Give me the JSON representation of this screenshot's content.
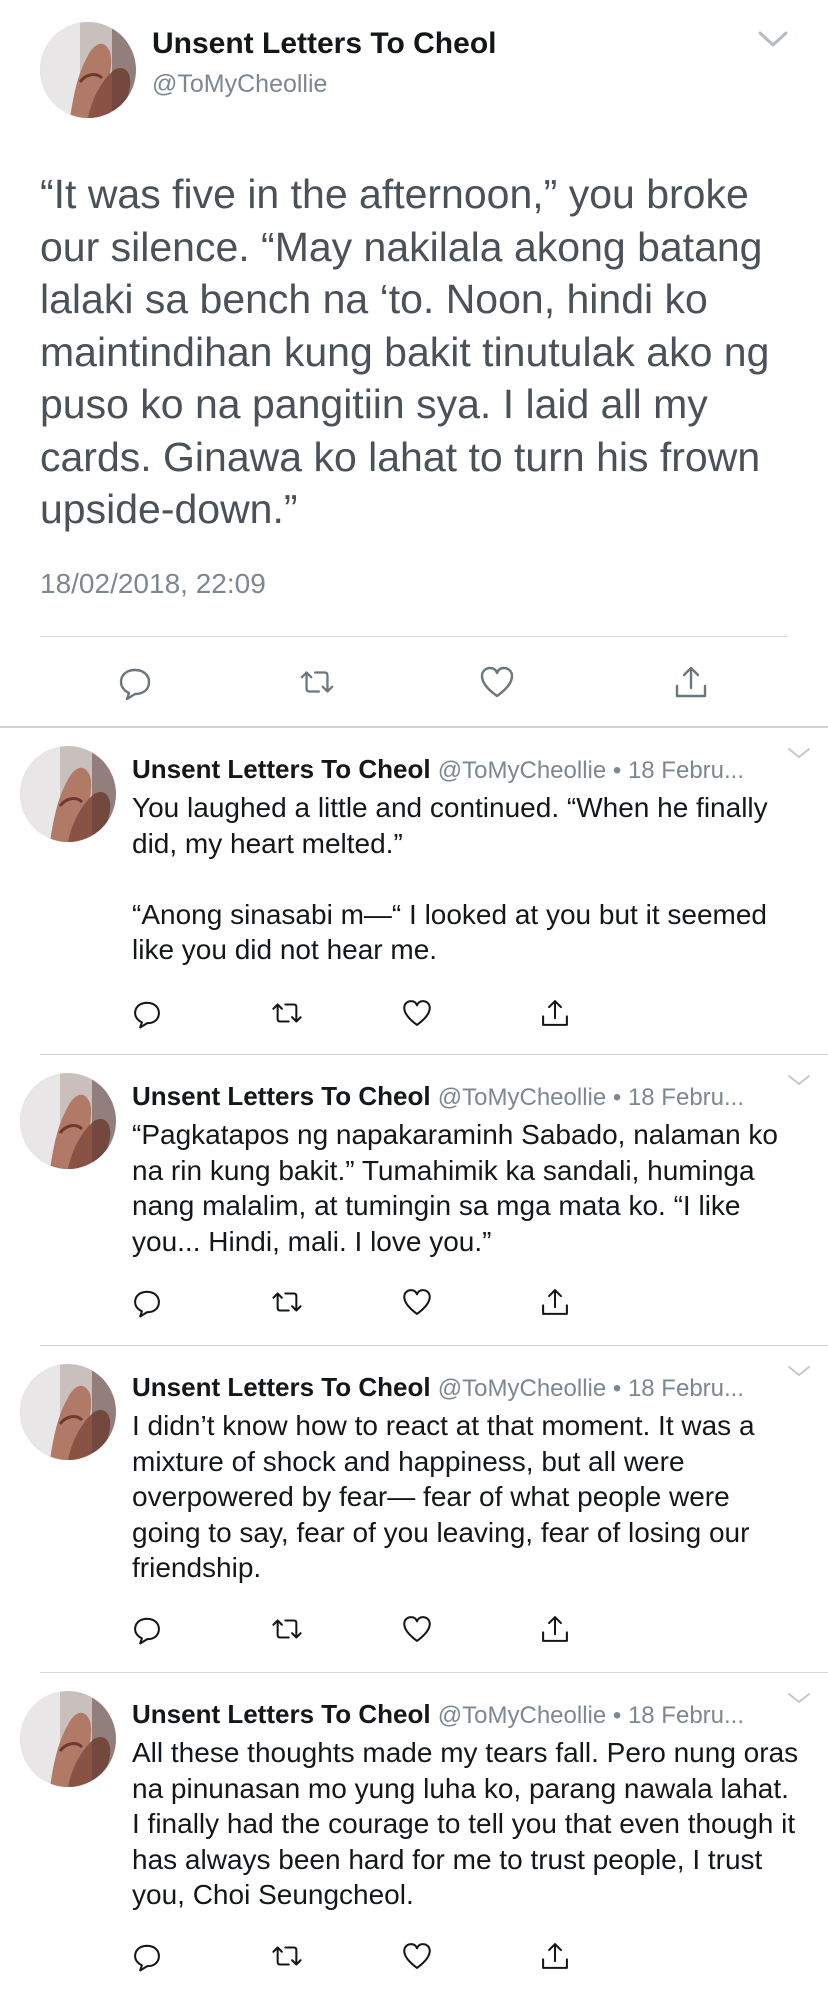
{
  "main_tweet": {
    "author_name": "Unsent Letters To Cheol",
    "author_handle": "@ToMyCheollie",
    "text": "“It was five in the afternoon,” you broke our silence. “May nakilala akong batang lalaki sa bench na ‘to. Noon, hindi ko maintindihan kung bakit tinutulak ako ng puso ko na pangitiin sya. I laid all my cards. Ginawa ko lahat to turn his frown upside-down.”",
    "timestamp": "18/02/2018, 22:09"
  },
  "actions": [
    "reply-icon",
    "retweet-icon",
    "like-icon",
    "share-icon"
  ],
  "replies": [
    {
      "author_name": "Unsent Letters To Cheol",
      "meta": "@ToMyCheollie • 18 Febru...",
      "paragraphs": [
        "You laughed a little and continued. “When he finally did, my heart melted.”",
        "“Anong sinasabi m—“ I looked at you but it seemed like you did not hear me."
      ]
    },
    {
      "author_name": "Unsent Letters To Cheol",
      "meta": "@ToMyCheollie • 18 Febru...",
      "paragraphs": [
        "“Pagkatapos ng napakaraminh Sabado, nalaman ko na rin kung bakit.” Tumahimik ka sandali, huminga nang malalim, at tumingin sa mga mata ko. “I like you... Hindi, mali. I love you.”"
      ]
    },
    {
      "author_name": "Unsent Letters To Cheol",
      "meta": "@ToMyCheollie • 18 Febru...",
      "paragraphs": [
        "I didn’t know how to react at that moment. It was a mixture of shock and happiness, but all were overpowered by fear— fear of what people were going to say, fear of you leaving, fear of losing our friendship."
      ]
    },
    {
      "author_name": "Unsent Letters To Cheol",
      "meta": "@ToMyCheollie • 18 Febru...",
      "paragraphs": [
        "All these thoughts made my tears fall. Pero nung oras na pinunasan mo yung luha ko, parang nawala lahat. I finally had the courage to tell you that even though it has always been hard for me to trust people, I trust you, Choi Seungcheol."
      ]
    }
  ]
}
